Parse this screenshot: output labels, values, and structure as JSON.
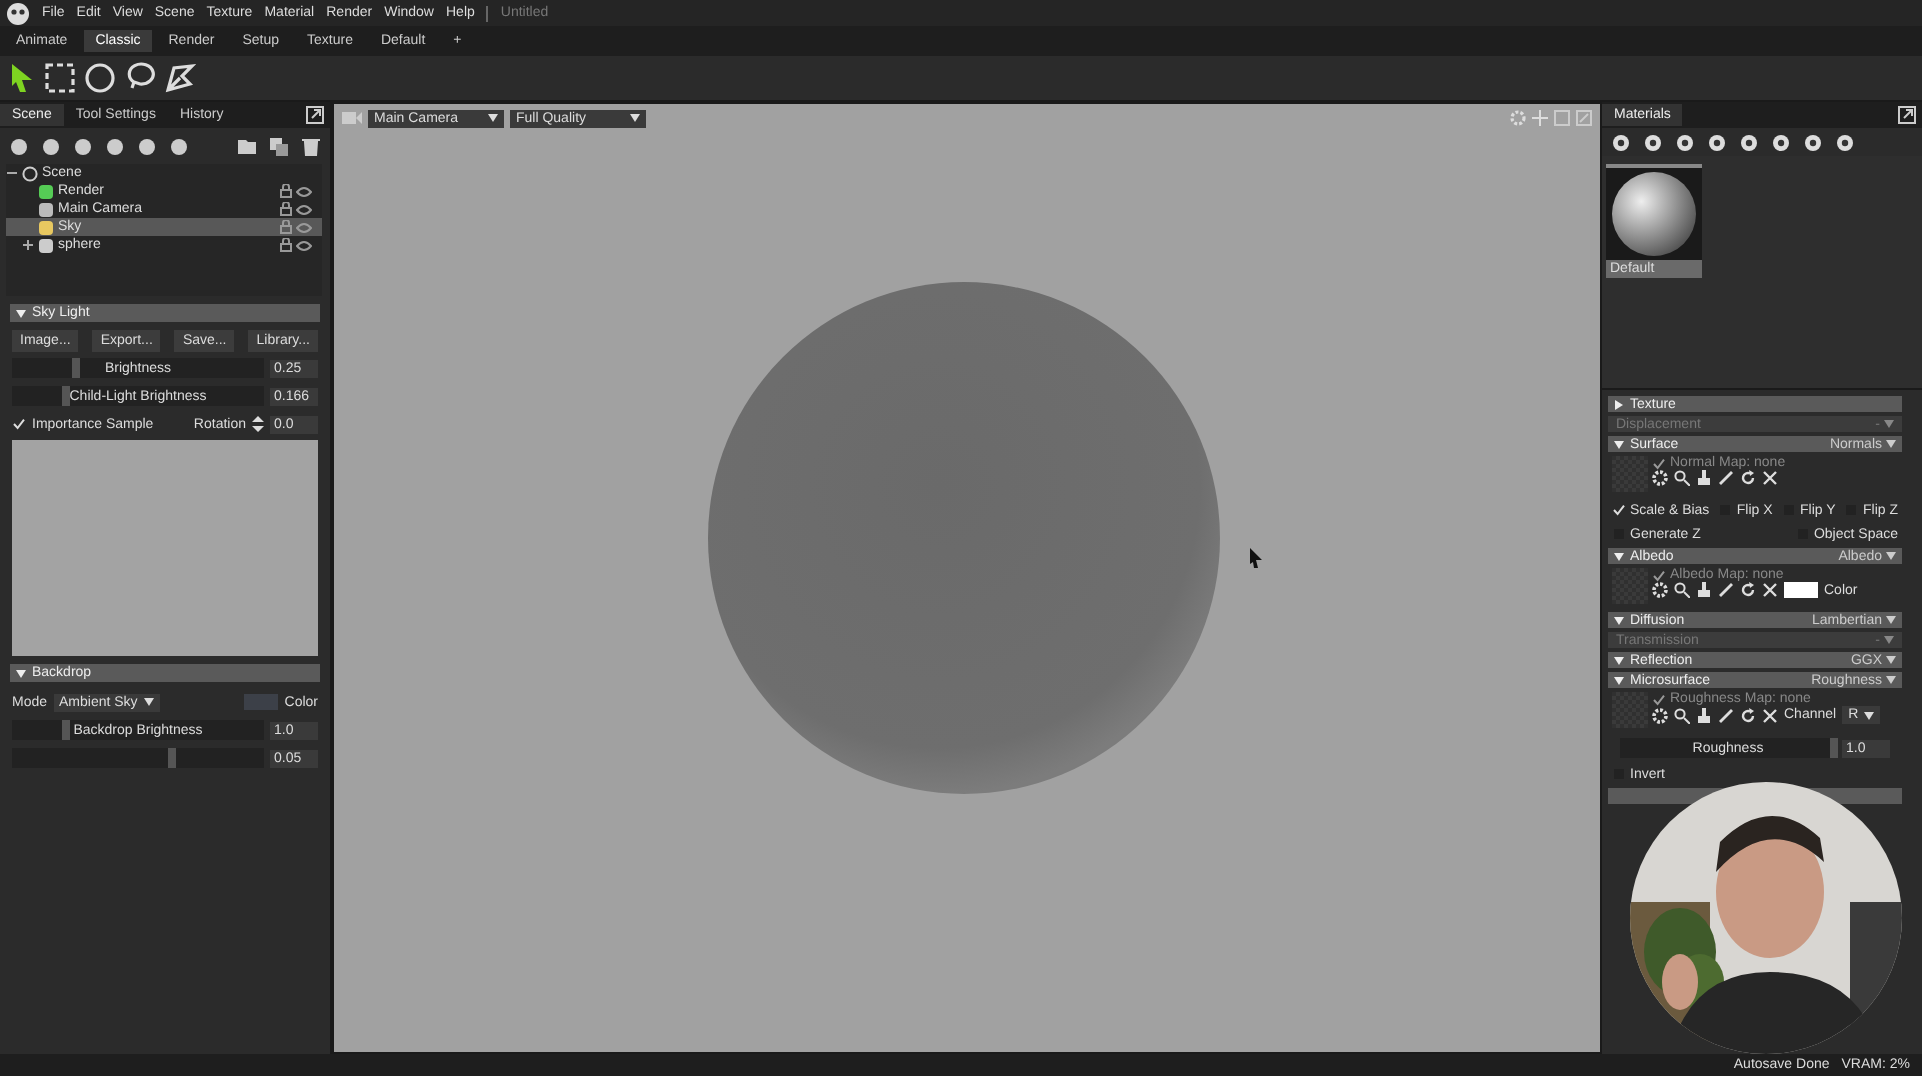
{
  "menu": {
    "items": [
      "File",
      "Edit",
      "View",
      "Scene",
      "Texture",
      "Material",
      "Render",
      "Window",
      "Help"
    ],
    "document": "Untitled"
  },
  "layout_tabs": [
    {
      "label": "Animate",
      "selected": false
    },
    {
      "label": "Classic",
      "selected": true
    },
    {
      "label": "Render",
      "selected": false
    },
    {
      "label": "Setup",
      "selected": false
    },
    {
      "label": "Texture",
      "selected": false
    },
    {
      "label": "Default",
      "selected": false
    }
  ],
  "add_tab": "+",
  "tools": [
    {
      "kind": "select",
      "selected": true
    },
    {
      "kind": "rect",
      "selected": false
    },
    {
      "kind": "circle",
      "selected": false
    },
    {
      "kind": "lasso",
      "selected": false
    },
    {
      "kind": "polygon",
      "selected": false
    }
  ],
  "left_panel": {
    "tabs": [
      {
        "label": "Scene",
        "selected": true
      },
      {
        "label": "Tool Settings",
        "selected": false
      },
      {
        "label": "History",
        "selected": false
      }
    ],
    "tree": {
      "label": "Scene",
      "expanded": true,
      "children": [
        {
          "label": "Render",
          "kind": "render",
          "selected": false
        },
        {
          "label": "Main Camera",
          "kind": "camera",
          "selected": false
        },
        {
          "label": "Sky",
          "kind": "sky",
          "selected": true
        },
        {
          "label": "sphere",
          "kind": "mesh",
          "selected": false,
          "expanded": false
        }
      ]
    },
    "sky_light": {
      "title": "Sky Light",
      "buttons": [
        "Image...",
        "Export...",
        "Save...",
        "Library..."
      ],
      "sliders": [
        {
          "label": "Brightness",
          "level": 0.24,
          "value": "0.25"
        },
        {
          "label": "Child-Light Brightness",
          "level": 0.2,
          "value": "0.166"
        }
      ],
      "importance_sample": {
        "label": "Importance Sample",
        "checked": true
      },
      "rotation": {
        "label": "Rotation",
        "value": "0.0"
      }
    },
    "backdrop": {
      "title": "Backdrop",
      "mode_label": "Mode",
      "mode": "Ambient Sky",
      "color_label": "Color",
      "sliders": [
        {
          "label": "Backdrop Brightness",
          "level": 0.2,
          "value": "1.0"
        },
        {
          "level": 0.62,
          "value": "0.05"
        }
      ]
    }
  },
  "viewport": {
    "camera": "Main Camera",
    "quality": "Full Quality"
  },
  "materials": {
    "tab": "Materials",
    "thumbnails": [
      {
        "label": "Default",
        "selected": true
      }
    ],
    "sections": [
      {
        "kind": "header",
        "title": "Texture",
        "expanded": false
      },
      {
        "kind": "disabled",
        "title": "Displacement",
        "value": "-"
      },
      {
        "kind": "header",
        "title": "Surface",
        "value": "Normals",
        "expanded": true
      },
      {
        "kind": "map",
        "label": "Normal Map: none",
        "checked": true
      },
      {
        "kind": "checks",
        "items": [
          {
            "label": "Scale & Bias",
            "checked": true
          },
          {
            "label": "Flip X",
            "checked": false
          },
          {
            "label": "Flip Y",
            "checked": false
          },
          {
            "label": "Flip Z",
            "checked": false
          }
        ]
      },
      {
        "kind": "checks",
        "items": [
          {
            "label": "Generate Z",
            "checked": false
          },
          {
            "label": "Object Space",
            "checked": false
          }
        ]
      },
      {
        "kind": "header",
        "title": "Albedo",
        "value": "Albedo",
        "expanded": true
      },
      {
        "kind": "map",
        "label": "Albedo Map: none",
        "checked": true,
        "color": "#ffffff",
        "color_label": "Color"
      },
      {
        "kind": "header",
        "title": "Diffusion",
        "value": "Lambertian",
        "expanded": true
      },
      {
        "kind": "disabled",
        "title": "Transmission",
        "value": "-"
      },
      {
        "kind": "header",
        "title": "Reflection",
        "value": "GGX",
        "expanded": true
      },
      {
        "kind": "header",
        "title": "Microsurface",
        "value": "Roughness",
        "expanded": true
      },
      {
        "kind": "map",
        "label": "Roughness Map: none",
        "checked": true,
        "channel_label": "Channel",
        "channel": "R"
      },
      {
        "kind": "slider",
        "label": "Roughness",
        "level": 1.0,
        "value": "1.0"
      },
      {
        "kind": "checks",
        "items": [
          {
            "label": "Invert",
            "checked": false
          }
        ]
      }
    ]
  },
  "webcam": {
    "kind": "picture"
  },
  "status": [
    "Autosave Done",
    "VRAM: 2%"
  ]
}
